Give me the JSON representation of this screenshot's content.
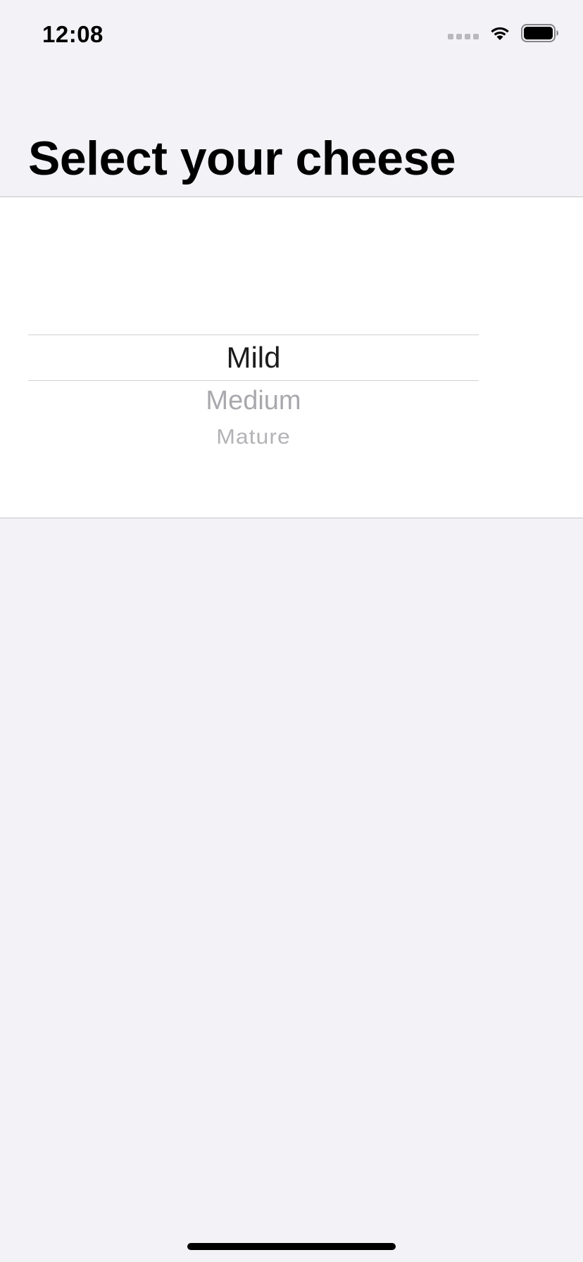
{
  "status_bar": {
    "time": "12:08",
    "icons": [
      "cellular-signal-icon",
      "wifi-icon",
      "battery-icon"
    ]
  },
  "nav": {
    "title": "Select your cheese"
  },
  "picker": {
    "options": [
      "Mild",
      "Medium",
      "Mature"
    ],
    "selected": "Mild"
  },
  "colors": {
    "background": "#f2f2f7",
    "panel": "#ffffff",
    "title": "#000000",
    "selected_text": "#1c1c1e",
    "unselected_text": "#a8a8ad",
    "separator": "#c6c6c8"
  }
}
